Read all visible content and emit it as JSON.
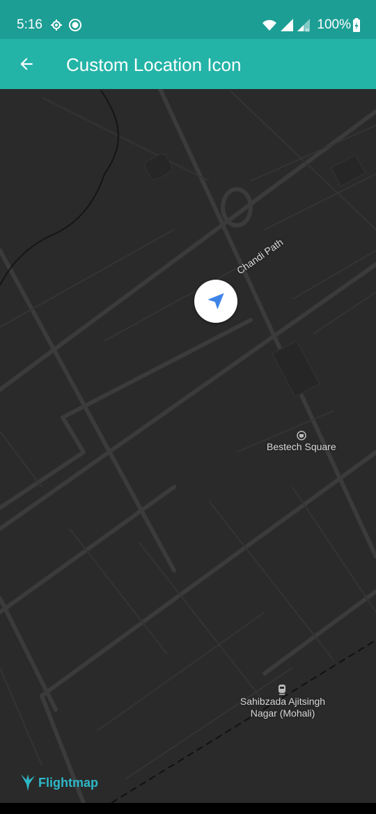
{
  "status_bar": {
    "time": "5:16",
    "battery": "100%",
    "icons": [
      "location-icon",
      "record-icon",
      "wifi-icon",
      "signal-icon",
      "signal-r-icon",
      "battery-charging-icon"
    ]
  },
  "app_bar": {
    "title": "Custom Location Icon",
    "back_icon": "arrow-back-icon",
    "color": "#24b3a7"
  },
  "map": {
    "theme": "dark",
    "background": "#2a2a2a",
    "road_color": "#3b3b3b",
    "labels": {
      "street": "Chandi Path",
      "poi_bestech": "Bestech Square",
      "poi_mohali_line1": "Sahibzada Ajitsingh",
      "poi_mohali_line2": "Nagar (Mohali)"
    },
    "marker": {
      "icon": "navigation-arrow-icon",
      "color": "#3d84e6"
    },
    "attribution": "Flightmap"
  }
}
